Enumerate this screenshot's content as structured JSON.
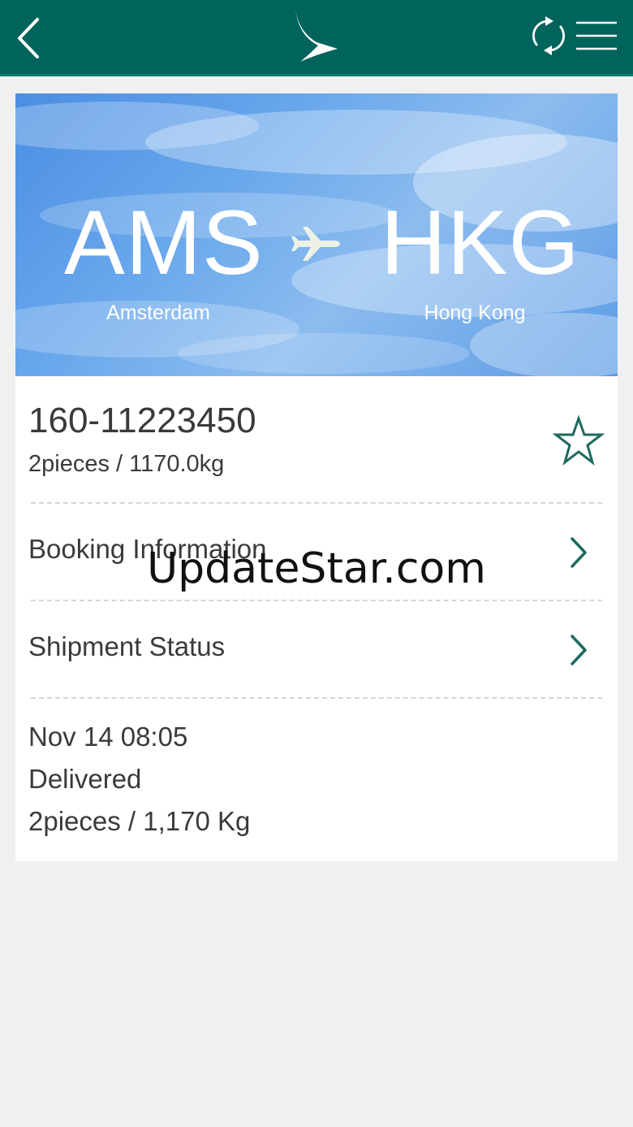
{
  "header": {
    "back_icon": "chevron-left-icon",
    "logo_icon": "airline-brushwing-logo",
    "refresh_icon": "refresh-icon",
    "menu_icon": "hamburger-menu-icon",
    "bg_color": "#00645c"
  },
  "route": {
    "origin_code": "AMS",
    "origin_city": "Amsterdam",
    "destination_code": "HKG",
    "destination_city": "Hong Kong",
    "plane_icon": "airplane-icon"
  },
  "shipment": {
    "awb_number": "160-11223450",
    "pieces_weight": "2pieces / 1170.0kg",
    "favorite_icon": "star-outline-icon"
  },
  "menu_rows": [
    {
      "label": "Booking Information",
      "icon": "chevron-right-icon"
    },
    {
      "label": "Shipment Status",
      "icon": "chevron-right-icon"
    }
  ],
  "latest_status": {
    "datetime": "Nov 14 08:05",
    "status": "Delivered",
    "pieces_weight": "2pieces / 1,170 Kg"
  },
  "watermark": "UpdateStar.com",
  "accent_color": "#1c6b60"
}
